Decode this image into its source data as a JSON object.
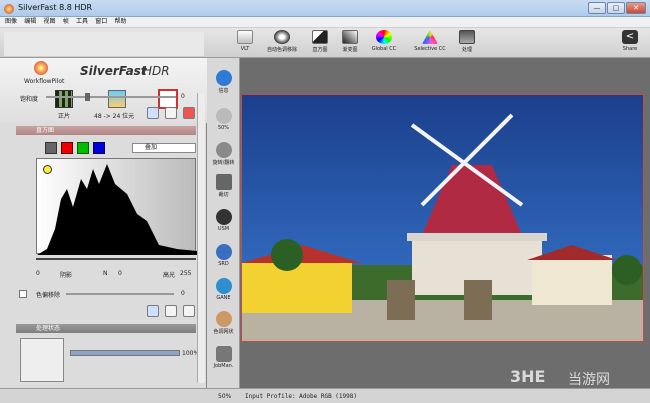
{
  "window": {
    "title": "SilverFast 8.8 HDR",
    "controls": [
      "—",
      "□",
      "✕"
    ]
  },
  "menu": [
    "图像",
    "编辑",
    "视图",
    "帧",
    "工具",
    "窗口",
    "帮助"
  ],
  "toolbar": [
    {
      "label": "VLT",
      "icon": "vlt-icon"
    },
    {
      "label": "自动色调移除",
      "icon": "auto-tone-icon"
    },
    {
      "label": "直方图",
      "icon": "histogram-icon"
    },
    {
      "label": "渐变图",
      "icon": "gradation-icon"
    },
    {
      "label": "Global CC",
      "icon": "global-cc-icon"
    },
    {
      "label": "Selective CC",
      "icon": "selective-cc-icon"
    },
    {
      "label": "处理",
      "icon": "process-icon"
    }
  ],
  "share": {
    "label": "Share"
  },
  "left": {
    "brand": "SilverFast",
    "brand_hdr": "HDR",
    "workflow": "WorkflowPilot",
    "modes": [
      {
        "label": "正片"
      },
      {
        "label": "48 -> 24 位元"
      },
      {
        "label": "帧"
      }
    ],
    "saturation_label": "饱和度",
    "saturation_value": "0",
    "histogram_title": "直方图",
    "mode_select": "叠加",
    "shadow_value": "0",
    "shadow_label": "阴影",
    "n_label": "N",
    "n_value": "0",
    "highlight_label": "高光",
    "highlight_value": "255",
    "color_cast_label": "色偏移除",
    "color_cast_value": "0",
    "process_title": "处理状态",
    "progress_percent": "100%",
    "progress": 1.0
  },
  "vtools": [
    {
      "label": "信息"
    },
    {
      "label": "50%"
    },
    {
      "label": "旋转/翻转"
    },
    {
      "label": "裁切"
    },
    {
      "label": "USM"
    },
    {
      "label": "SRD"
    },
    {
      "label": "GANE"
    },
    {
      "label": "色调网状"
    },
    {
      "label": "JobMan."
    }
  ],
  "status": {
    "zoom": "50%",
    "profile": "Input Profile: Adobe RGB (1998)"
  },
  "watermark": {
    "brand": "3HE",
    "text": "当游网"
  }
}
